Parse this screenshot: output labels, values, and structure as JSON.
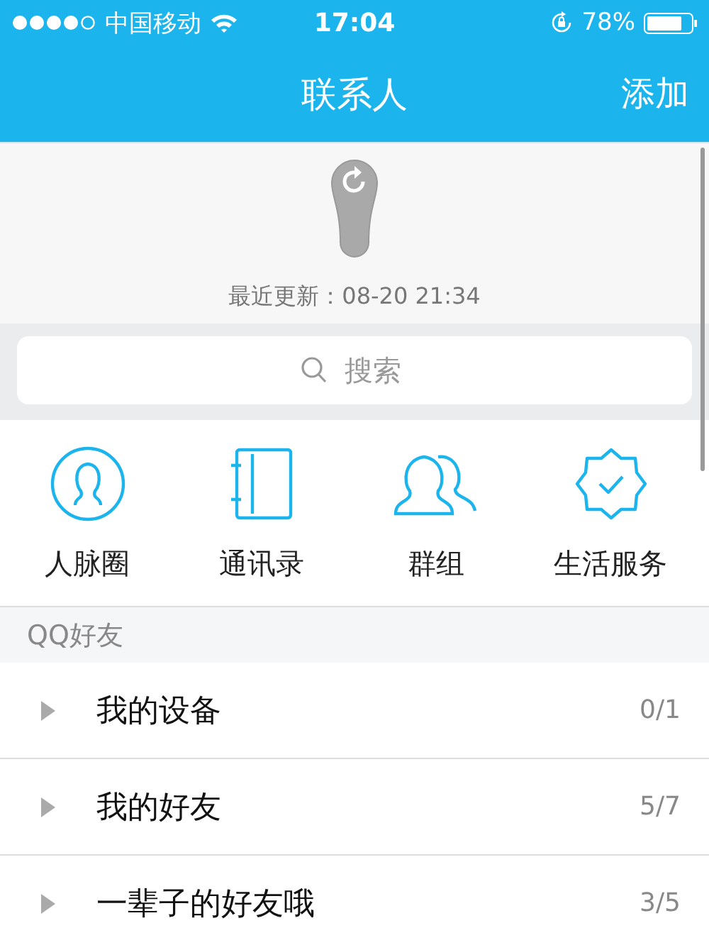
{
  "status_bar": {
    "carrier": "中国移动",
    "time": "17:04",
    "battery": "78%"
  },
  "nav_bar": {
    "title": "联系人",
    "action": "添加"
  },
  "refresh": {
    "last_updated": "最近更新：08-20 21:34"
  },
  "search": {
    "placeholder": "搜索"
  },
  "shortcuts": [
    {
      "kind": "circle",
      "label": "人脉圈"
    },
    {
      "kind": "book",
      "label": "通讯录"
    },
    {
      "kind": "group",
      "label": "群组"
    },
    {
      "kind": "badge",
      "label": "生活服务"
    }
  ],
  "section": {
    "title": "QQ好友"
  },
  "groups": [
    {
      "name": "我的设备",
      "count": "0/1",
      "expanded": false
    },
    {
      "name": "我的好友",
      "count": "5/7",
      "expanded": false
    },
    {
      "name": "一辈子的好友哦",
      "count": "3/5",
      "expanded": false
    }
  ]
}
